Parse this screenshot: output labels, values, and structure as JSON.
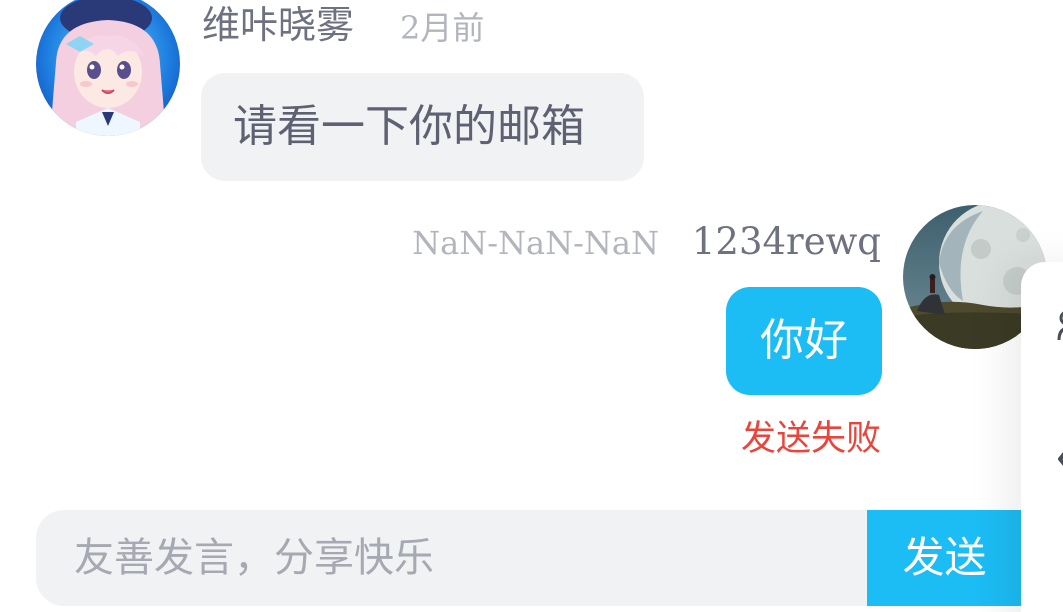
{
  "chat": {
    "messages": [
      {
        "sender": "维咔晓雾",
        "time": "2月前",
        "text": "请看一下你的邮箱",
        "avatar": "anime-girl-avatar"
      },
      {
        "sender": "1234rewq",
        "time": "NaN-NaN-NaN",
        "text": "你好",
        "status": "发送失败",
        "avatar": "moon-landscape-avatar"
      }
    ]
  },
  "composer": {
    "placeholder": "友善发言，分享快乐",
    "value": "",
    "send_label": "发送"
  },
  "side_panel": {
    "icons": [
      "user-icon",
      "back-icon"
    ]
  },
  "colors": {
    "accent": "#1cbcf4",
    "bubble_incoming": "#f1f2f4",
    "error": "#e8453c",
    "muted": "#b3b5bd",
    "name": "#6e7180"
  }
}
